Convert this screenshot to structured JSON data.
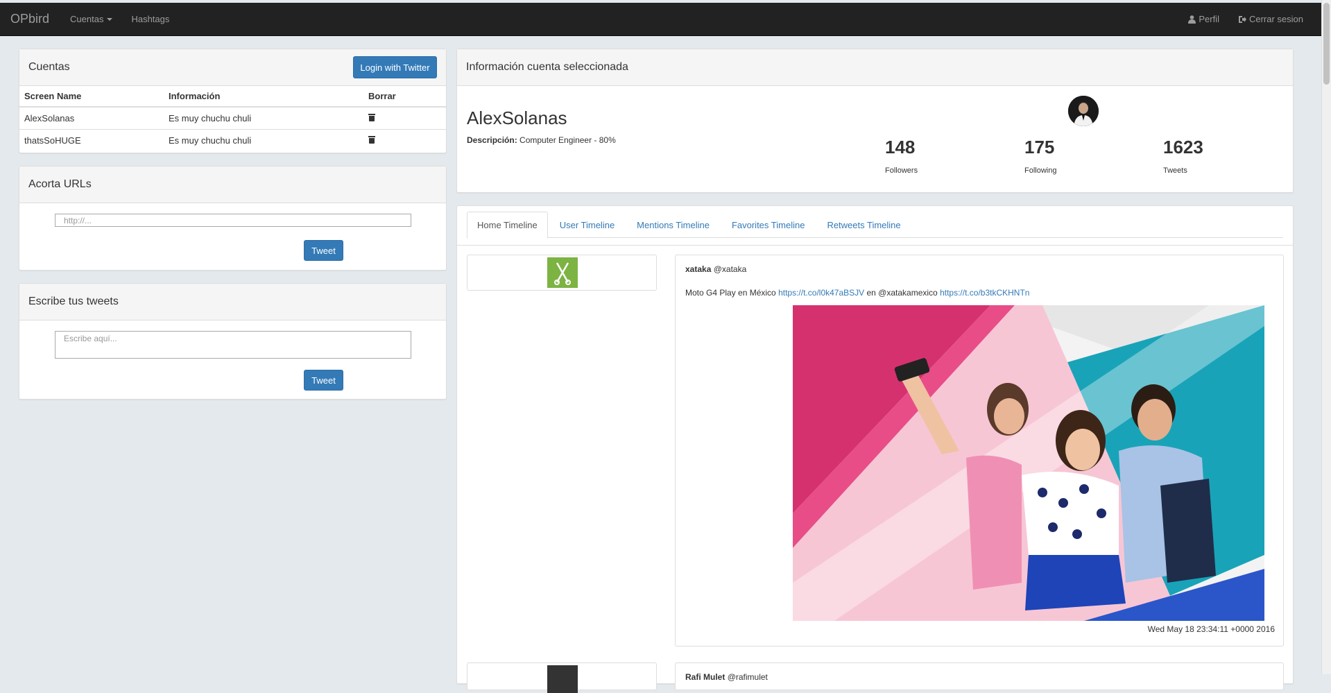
{
  "navbar": {
    "brand": "OPbird",
    "cuentas": "Cuentas",
    "hashtags": "Hashtags",
    "perfil": "Perfil",
    "cerrar": "Cerrar sesion"
  },
  "cuentas": {
    "title": "Cuentas",
    "login_button": "Login with Twitter",
    "columns": [
      "Screen Name",
      "Información",
      "Borrar"
    ],
    "rows": [
      {
        "screen_name": "AlexSolanas",
        "info": "Es muy chuchu chuli"
      },
      {
        "screen_name": "thatsSoHUGE",
        "info": "Es muy chuchu chuli"
      }
    ]
  },
  "acorta": {
    "title": "Acorta URLs",
    "placeholder": "http://...",
    "button": "Tweet"
  },
  "escribe": {
    "title": "Escribe tus tweets",
    "placeholder": "Escribe aquí...",
    "button": "Tweet"
  },
  "info": {
    "title": "Información cuenta seleccionada",
    "name": "AlexSolanas",
    "desc_label": "Descripción:",
    "desc_value": "Computer Engineer - 80%",
    "stats": [
      {
        "value": "148",
        "label": "Followers"
      },
      {
        "value": "175",
        "label": "Following"
      },
      {
        "value": "1623",
        "label": "Tweets"
      }
    ]
  },
  "tabs": [
    "Home Timeline",
    "User Timeline",
    "Mentions Timeline",
    "Favorites Timeline",
    "Retweets Timeline"
  ],
  "tweet": {
    "author": "xataka",
    "handle": "@xataka",
    "text_1": "Moto G4 Play en México",
    "link_1": "https://t.co/l0k47aBSJV",
    "text_2": "en @xatakamexico",
    "link_2": "https://t.co/b3tkCKHNTn",
    "timestamp": "Wed May 18 23:34:11 +0000 2016"
  },
  "tweet2": {
    "author": "Rafi Mulet",
    "handle": "@rafimulet"
  },
  "colors": {
    "navbar_bg": "#222222",
    "page_bg": "#e3e9ec",
    "primary": "#337ab7",
    "xataka_green": "#8cc63f"
  }
}
